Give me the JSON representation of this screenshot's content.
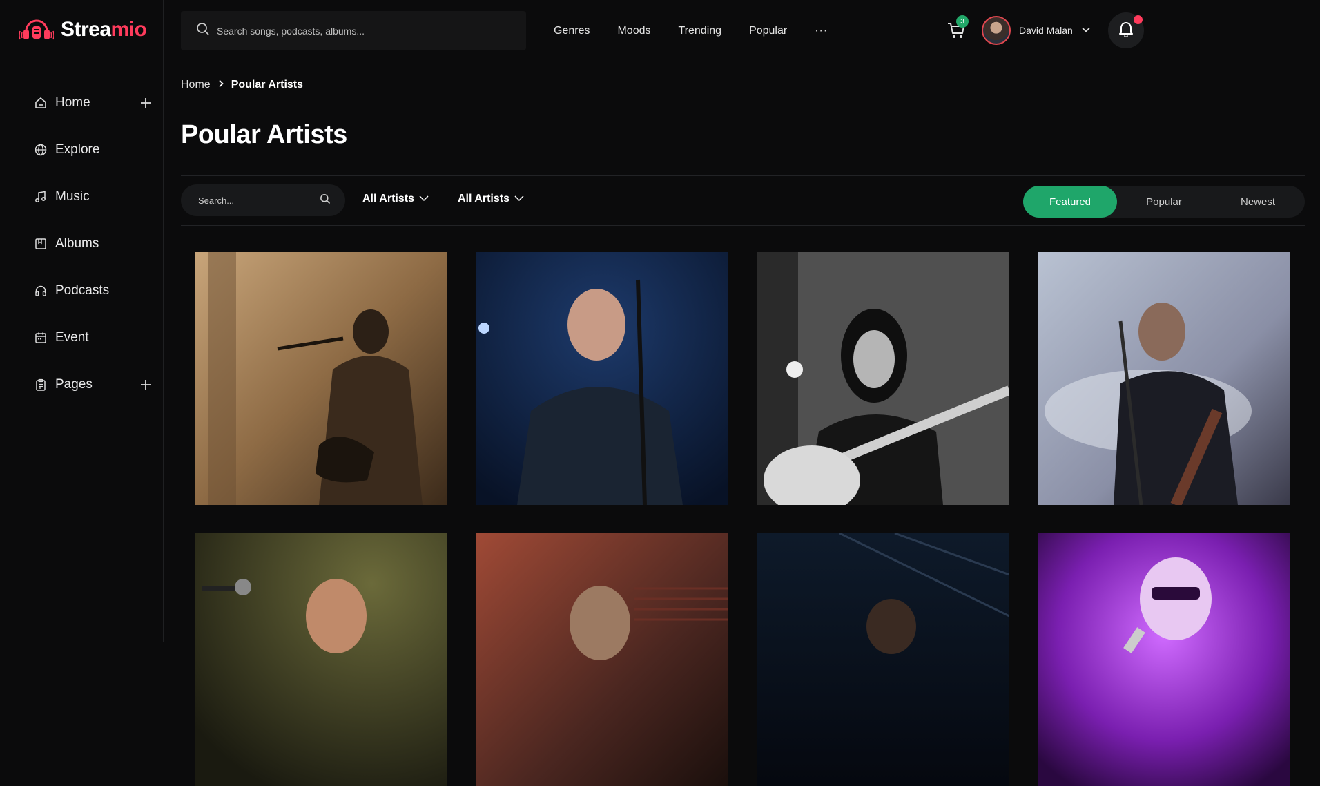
{
  "app": {
    "name_main": "Strea",
    "name_accent": "mio",
    "brand_color": "#ff3b5c",
    "accent_green": "#1fa66a"
  },
  "header": {
    "search_placeholder": "Search songs, podcasts, albums...",
    "nav": [
      "Genres",
      "Moods",
      "Trending",
      "Popular"
    ],
    "more": "···",
    "cart_count": "3",
    "user_name": "David Malan"
  },
  "sidebar": {
    "items": [
      {
        "label": "Home",
        "icon": "home-icon",
        "expandable": true
      },
      {
        "label": "Explore",
        "icon": "globe-icon",
        "expandable": false
      },
      {
        "label": "Music",
        "icon": "music-note-icon",
        "expandable": false
      },
      {
        "label": "Albums",
        "icon": "album-icon",
        "expandable": false
      },
      {
        "label": "Podcasts",
        "icon": "headphones-icon",
        "expandable": false
      },
      {
        "label": "Event",
        "icon": "calendar-icon",
        "expandable": false
      },
      {
        "label": "Pages",
        "icon": "clipboard-icon",
        "expandable": true
      }
    ]
  },
  "breadcrumb": {
    "home": "Home",
    "current": "Poular Artists"
  },
  "page": {
    "title": "Poular Artists"
  },
  "filters": {
    "search_placeholder": "Search...",
    "dropdown_1": "All Artists",
    "dropdown_2": "All Artists",
    "tabs": [
      "Featured",
      "Popular",
      "Newest"
    ],
    "active_tab": "Featured"
  },
  "artists": [
    {
      "tone": "sepia"
    },
    {
      "tone": "blue"
    },
    {
      "tone": "mono"
    },
    {
      "tone": "haze"
    },
    {
      "tone": "olive"
    },
    {
      "tone": "rust"
    },
    {
      "tone": "navy"
    },
    {
      "tone": "purple"
    }
  ]
}
